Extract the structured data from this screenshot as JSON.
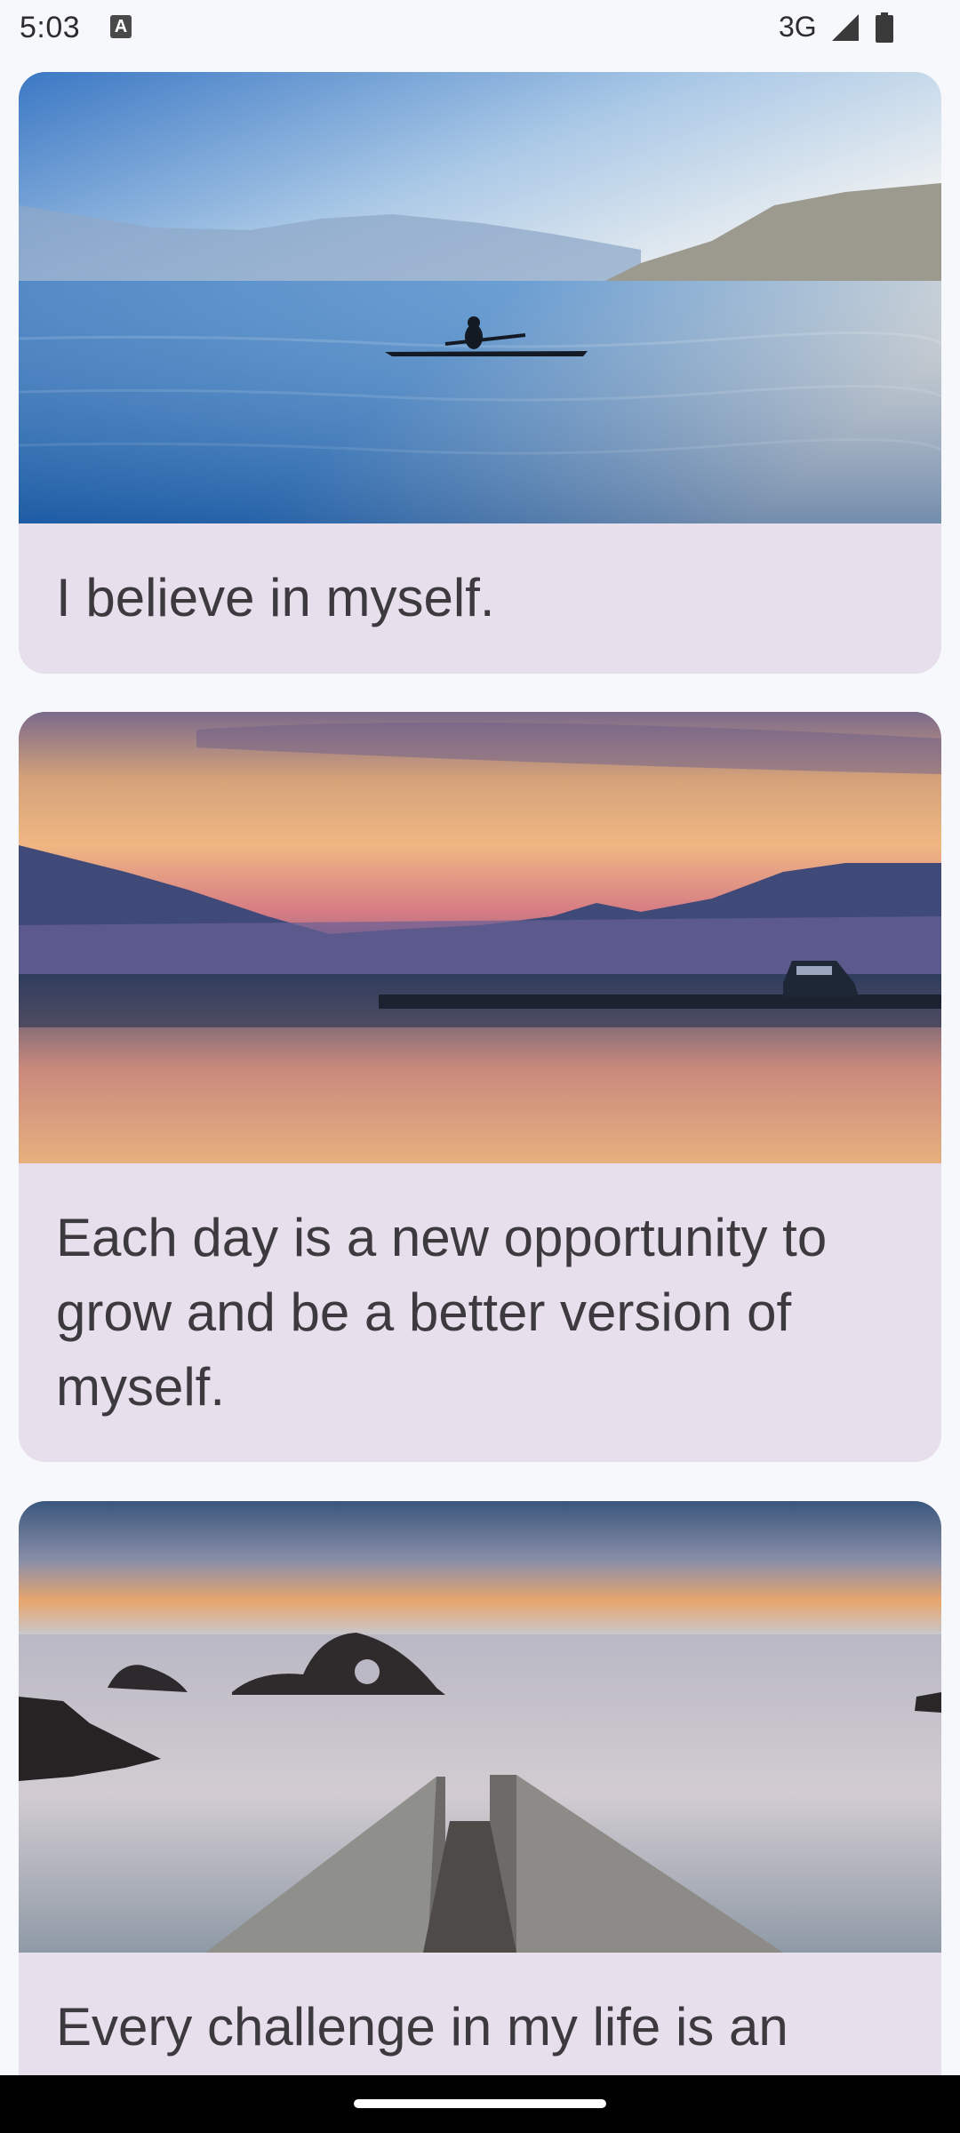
{
  "status_bar": {
    "time": "5:03",
    "network": "3G",
    "notification_icon": "a-icon",
    "signal_icon": "signal-icon",
    "battery_icon": "battery-icon"
  },
  "cards": [
    {
      "text": "I believe in myself.",
      "image": "lake-kayak-photo"
    },
    {
      "text": "Each day is a new opportunity to grow and be a better version of myself.",
      "image": "sunset-lake-dock-photo"
    },
    {
      "text": "Every challenge in my life is an",
      "image": "seaside-ramp-rocks-photo"
    }
  ],
  "colors": {
    "background": "#f7f8fc",
    "card": "#e7dfeb",
    "text": "#3c3a3f"
  }
}
